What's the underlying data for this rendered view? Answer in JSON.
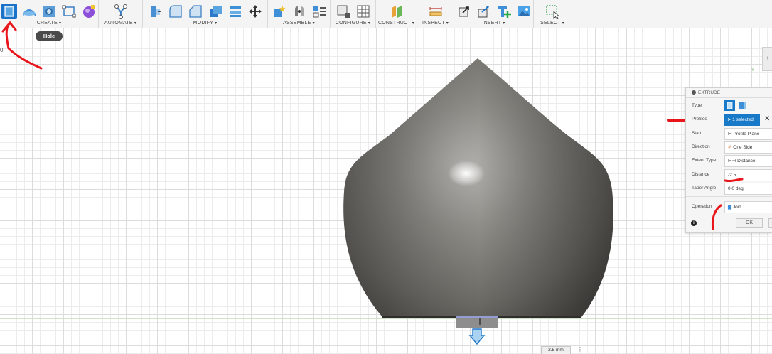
{
  "toolbar": {
    "groups": [
      {
        "label": "CREATE"
      },
      {
        "label": "AUTOMATE"
      },
      {
        "label": "MODIFY"
      },
      {
        "label": "ASSEMBLE"
      },
      {
        "label": "CONFIGURE"
      },
      {
        "label": "CONSTRUCT"
      },
      {
        "label": "INSPECT"
      },
      {
        "label": "INSERT"
      },
      {
        "label": "SELECT"
      }
    ],
    "caret": "▾"
  },
  "tooltip": "Hole",
  "left_fragment": "0",
  "viewcube_label": "t",
  "axis_label": "Y",
  "extrude": {
    "title": "EXTRUDE",
    "type_label": "Type",
    "profiles_label": "Profiles",
    "profiles_value": "1 selected",
    "clear_symbol": "✕",
    "start_label": "Start",
    "start_value": "Profile Plane",
    "direction_label": "Direction",
    "direction_value": "One Side",
    "extent_label": "Extent Type",
    "extent_value": "Distance",
    "distance_label": "Distance",
    "distance_value": "-2.5",
    "taper_label": "Taper Angle",
    "taper_value": "0.0 deg",
    "operation_label": "Operation",
    "operation_value": "Join",
    "ok_label": "OK",
    "info_symbol": "i"
  },
  "distance_readout": "-2.5 mm",
  "distance_menu": "⋮",
  "colors": {
    "accent": "#1979c9",
    "annotation": "#e8151b",
    "shape_dark": "#5c5a55",
    "shape_light": "#a9a7a2"
  }
}
